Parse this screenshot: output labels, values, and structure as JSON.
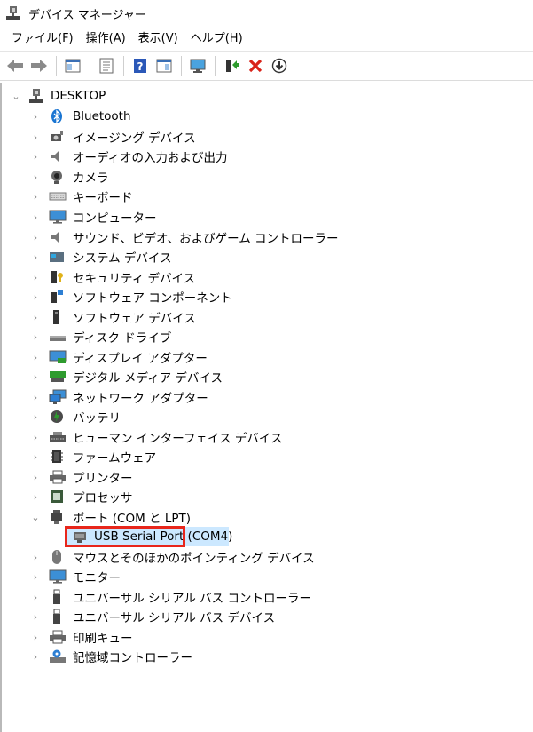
{
  "window": {
    "title": "デバイス マネージャー"
  },
  "menu": [
    {
      "label": "ファイル(F)"
    },
    {
      "label": "操作(A)"
    },
    {
      "label": "表示(V)"
    },
    {
      "label": "ヘルプ(H)"
    }
  ],
  "toolbar": [
    {
      "name": "back-button",
      "icon": "arrow-left-icon"
    },
    {
      "name": "forward-button",
      "icon": "arrow-right-icon"
    },
    {
      "name": "show-hide-console-tree-button",
      "icon": "console-tree-icon"
    },
    {
      "name": "properties-button",
      "icon": "properties-icon"
    },
    {
      "name": "help-button",
      "icon": "help-icon"
    },
    {
      "name": "action-pane-button",
      "icon": "action-pane-icon"
    },
    {
      "name": "scan-hardware-button",
      "icon": "monitor-scan-icon"
    },
    {
      "name": "update-driver-button",
      "icon": "update-driver-icon"
    },
    {
      "name": "uninstall-device-button",
      "icon": "red-x-icon"
    },
    {
      "name": "disable-device-button",
      "icon": "down-arrow-circle-icon"
    }
  ],
  "tree": {
    "root": {
      "label": "DESKTOP",
      "icon": "computer-icon",
      "expanded": true
    },
    "categories": [
      {
        "label": "Bluetooth",
        "icon": "bluetooth-icon"
      },
      {
        "label": "イメージング デバイス",
        "icon": "camera-device-icon"
      },
      {
        "label": "オーディオの入力および出力",
        "icon": "speaker-icon"
      },
      {
        "label": "カメラ",
        "icon": "webcam-icon"
      },
      {
        "label": "キーボード",
        "icon": "keyboard-icon"
      },
      {
        "label": "コンピューター",
        "icon": "monitor-icon"
      },
      {
        "label": "サウンド、ビデオ、およびゲーム コントローラー",
        "icon": "speaker-icon"
      },
      {
        "label": "システム デバイス",
        "icon": "system-device-icon"
      },
      {
        "label": "セキュリティ デバイス",
        "icon": "security-key-icon"
      },
      {
        "label": "ソフトウェア コンポーネント",
        "icon": "software-component-icon"
      },
      {
        "label": "ソフトウェア デバイス",
        "icon": "software-device-icon"
      },
      {
        "label": "ディスク ドライブ",
        "icon": "disk-drive-icon"
      },
      {
        "label": "ディスプレイ アダプター",
        "icon": "display-adapter-icon"
      },
      {
        "label": "デジタル メディア デバイス",
        "icon": "media-device-icon"
      },
      {
        "label": "ネットワーク アダプター",
        "icon": "network-adapter-icon"
      },
      {
        "label": "バッテリ",
        "icon": "battery-icon"
      },
      {
        "label": "ヒューマン インターフェイス デバイス",
        "icon": "hid-icon"
      },
      {
        "label": "ファームウェア",
        "icon": "firmware-icon"
      },
      {
        "label": "プリンター",
        "icon": "printer-icon"
      },
      {
        "label": "プロセッサ",
        "icon": "processor-icon"
      },
      {
        "label": "ポート (COM と LPT)",
        "icon": "port-icon",
        "expanded": true,
        "children": [
          {
            "label": "USB Serial Port (COM4)",
            "icon": "port-connector-icon",
            "selected": true
          }
        ]
      },
      {
        "label": "マウスとそのほかのポインティング デバイス",
        "icon": "mouse-icon"
      },
      {
        "label": "モニター",
        "icon": "monitor-icon"
      },
      {
        "label": "ユニバーサル シリアル バス コントローラー",
        "icon": "usb-icon"
      },
      {
        "label": "ユニバーサル シリアル バス デバイス",
        "icon": "usb-icon"
      },
      {
        "label": "印刷キュー",
        "icon": "printer-icon"
      },
      {
        "label": "記憶域コントローラー",
        "icon": "storage-controller-icon"
      }
    ]
  },
  "colors": {
    "selection": "#cce8ff",
    "highlight_box": "#e8261b"
  }
}
